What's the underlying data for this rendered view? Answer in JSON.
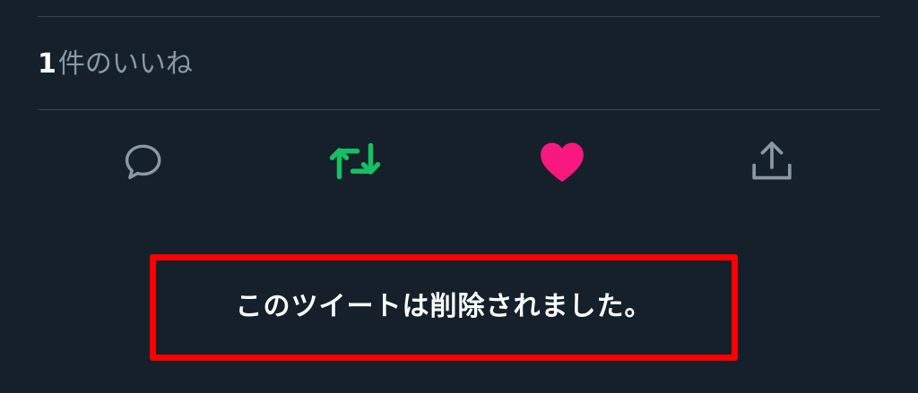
{
  "likes": {
    "count": "1",
    "label": "件のいいね"
  },
  "actions": [
    {
      "name": "reply",
      "icon": "reply-icon",
      "color": "#8899a6",
      "active": false
    },
    {
      "name": "retweet",
      "icon": "retweet-icon",
      "color": "#17bf63",
      "active": true
    },
    {
      "name": "like",
      "icon": "heart-icon",
      "color": "#e0245e",
      "active": true
    },
    {
      "name": "share",
      "icon": "share-icon",
      "color": "#8899a6",
      "active": false
    }
  ],
  "notice": {
    "text": "このツイートは削除されました。",
    "highlight_color": "#ff0000"
  },
  "colors": {
    "background": "#15202b",
    "divider": "#38444d",
    "secondary_text": "#8899a6",
    "primary_text": "#ffffff"
  }
}
